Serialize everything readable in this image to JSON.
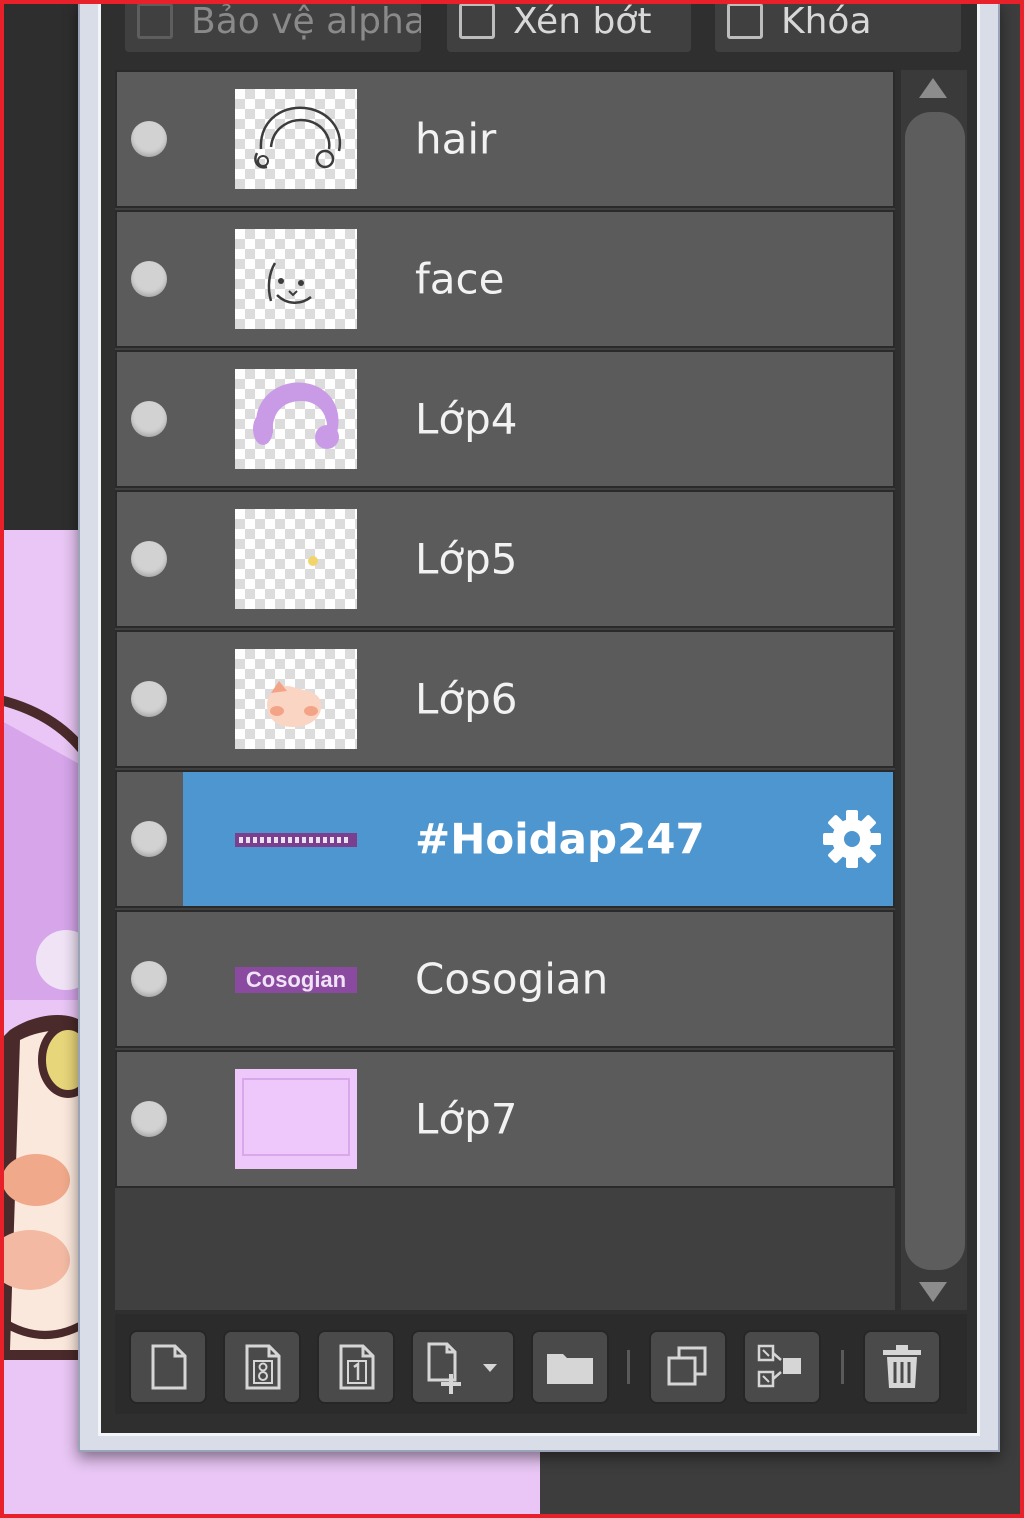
{
  "options": {
    "protect_alpha": "Bảo vệ alpha",
    "clipping": "Xén bớt",
    "lock": "Khóa"
  },
  "layers": [
    {
      "name": "hair",
      "thumb": "hair-sketch",
      "selected": false
    },
    {
      "name": "face",
      "thumb": "face-sketch",
      "selected": false
    },
    {
      "name": "Lớp4",
      "thumb": "purple-hair",
      "selected": false
    },
    {
      "name": "Lớp5",
      "thumb": "yellow-dot",
      "selected": false
    },
    {
      "name": "Lớp6",
      "thumb": "peach-face",
      "selected": false
    },
    {
      "name": "#Hoidap247",
      "thumb": "text-strip",
      "selected": true
    },
    {
      "name": "Cosogian",
      "thumb": "cosogian-text",
      "selected": false
    },
    {
      "name": "Lớp7",
      "thumb": "pink-frame",
      "selected": false
    }
  ],
  "thumb_text": {
    "cosogian": "Cosogian"
  },
  "colors": {
    "selected_row": "#4e96cf",
    "row": "#5b5b5b",
    "canvas_pink": "#e9c6f5",
    "highlight_frame": "#e8202a"
  },
  "toolbar": [
    {
      "icon": "new-layer-icon"
    },
    {
      "icon": "new-8bit-layer-icon"
    },
    {
      "icon": "new-1bit-layer-icon"
    },
    {
      "icon": "add-layer-dropdown-icon"
    },
    {
      "icon": "folder-icon"
    },
    {
      "icon": "duplicate-layer-icon"
    },
    {
      "icon": "merge-layer-icon"
    },
    {
      "icon": "trash-icon"
    }
  ]
}
